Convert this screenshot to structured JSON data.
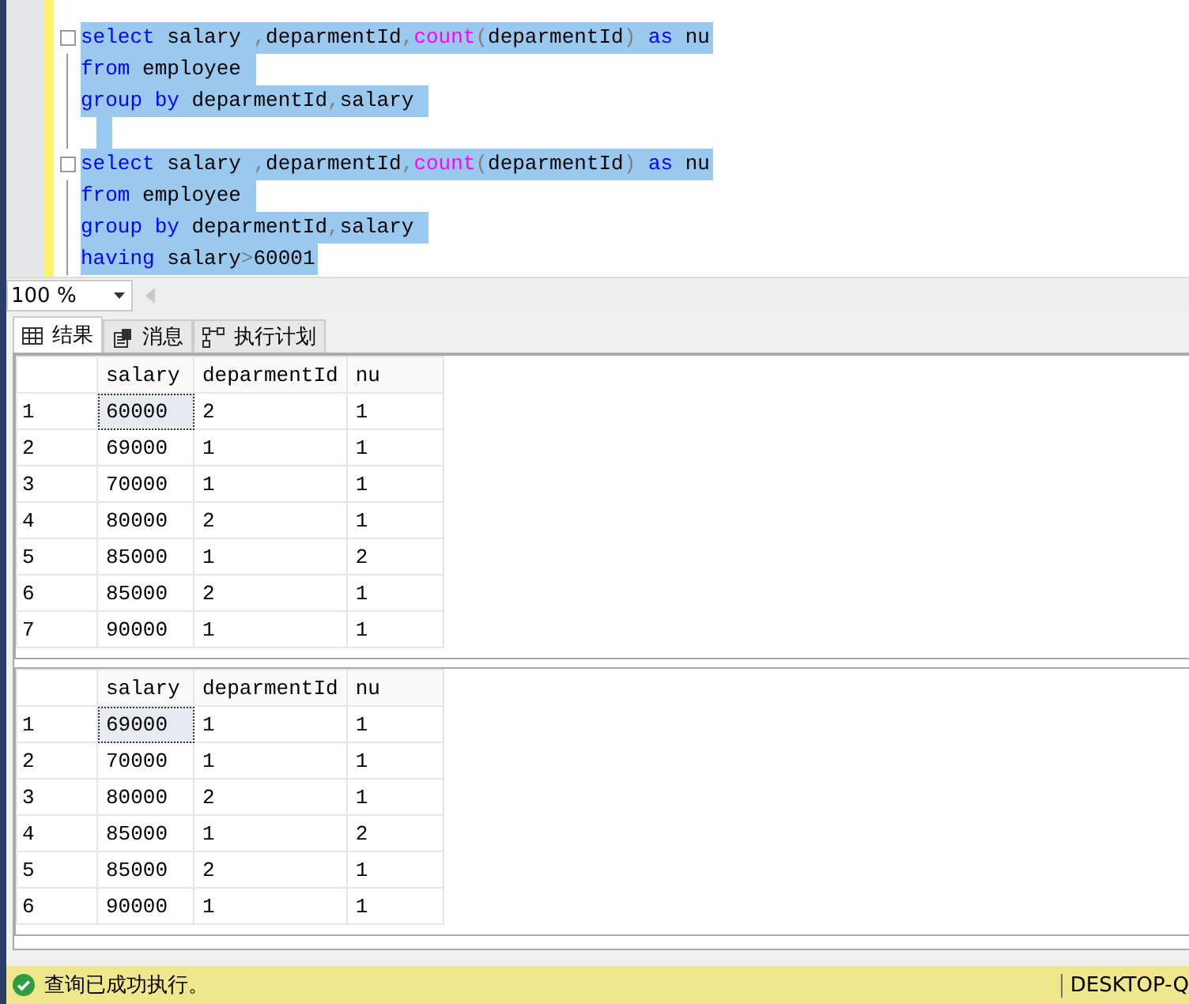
{
  "editor": {
    "lines": [
      {
        "tokens": [
          {
            "kind": "keyword",
            "text": "select"
          },
          {
            "kind": "plain",
            "text": " salary "
          },
          {
            "kind": "operator",
            "text": ","
          },
          {
            "kind": "plain",
            "text": "deparmentId"
          },
          {
            "kind": "operator",
            "text": ","
          },
          {
            "kind": "function",
            "text": "count"
          },
          {
            "kind": "operator",
            "text": "("
          },
          {
            "kind": "plain",
            "text": "deparmentId"
          },
          {
            "kind": "operator",
            "text": ")"
          },
          {
            "kind": "keyword",
            "text": " as"
          },
          {
            "kind": "plain",
            "text": " nu"
          }
        ],
        "selected": true,
        "fold": true
      },
      {
        "tokens": [
          {
            "kind": "keyword",
            "text": "from"
          },
          {
            "kind": "plain",
            "text": " employee "
          }
        ],
        "selected": true,
        "fold": false
      },
      {
        "tokens": [
          {
            "kind": "keyword",
            "text": "group"
          },
          {
            "kind": "keyword",
            "text": " by"
          },
          {
            "kind": "plain",
            "text": " deparmentId"
          },
          {
            "kind": "operator",
            "text": ","
          },
          {
            "kind": "plain",
            "text": "salary "
          }
        ],
        "selected": true,
        "fold": false
      },
      {
        "selected": true,
        "fold": false
      },
      {
        "tokens": [
          {
            "kind": "keyword",
            "text": "select"
          },
          {
            "kind": "plain",
            "text": " salary "
          },
          {
            "kind": "operator",
            "text": ","
          },
          {
            "kind": "plain",
            "text": "deparmentId"
          },
          {
            "kind": "operator",
            "text": ","
          },
          {
            "kind": "function",
            "text": "count"
          },
          {
            "kind": "operator",
            "text": "("
          },
          {
            "kind": "plain",
            "text": "deparmentId"
          },
          {
            "kind": "operator",
            "text": ")"
          },
          {
            "kind": "keyword",
            "text": " as"
          },
          {
            "kind": "plain",
            "text": " nu"
          }
        ],
        "selected": true,
        "fold": true
      },
      {
        "tokens": [
          {
            "kind": "keyword",
            "text": "from"
          },
          {
            "kind": "plain",
            "text": " employee "
          }
        ],
        "selected": true,
        "fold": false
      },
      {
        "tokens": [
          {
            "kind": "keyword",
            "text": "group"
          },
          {
            "kind": "keyword",
            "text": " by"
          },
          {
            "kind": "plain",
            "text": " deparmentId"
          },
          {
            "kind": "operator",
            "text": ","
          },
          {
            "kind": "plain",
            "text": "salary "
          }
        ],
        "selected": true,
        "fold": false
      },
      {
        "tokens": [
          {
            "kind": "keyword",
            "text": "having"
          },
          {
            "kind": "plain",
            "text": " salary"
          },
          {
            "kind": "operator",
            "text": ">"
          },
          {
            "kind": "plain",
            "text": "60001"
          }
        ],
        "selected": true,
        "fold": false
      }
    ]
  },
  "zoom": {
    "value": "100 %"
  },
  "tabs": [
    {
      "label": "结果",
      "selected": true
    },
    {
      "label": "消息",
      "selected": false
    },
    {
      "label": "执行计划",
      "selected": false
    }
  ],
  "grids": [
    {
      "columns": [
        "salary",
        "deparmentId",
        "nu"
      ],
      "rows": [
        {
          "number": "1",
          "cells": [
            "60000",
            "2",
            "1"
          ],
          "selected": true
        },
        {
          "number": "2",
          "cells": [
            "69000",
            "1",
            "1"
          ],
          "selected": false
        },
        {
          "number": "3",
          "cells": [
            "70000",
            "1",
            "1"
          ],
          "selected": false
        },
        {
          "number": "4",
          "cells": [
            "80000",
            "2",
            "1"
          ],
          "selected": false
        },
        {
          "number": "5",
          "cells": [
            "85000",
            "1",
            "2"
          ],
          "selected": false
        },
        {
          "number": "6",
          "cells": [
            "85000",
            "2",
            "1"
          ],
          "selected": false
        },
        {
          "number": "7",
          "cells": [
            "90000",
            "1",
            "1"
          ],
          "selected": false
        }
      ]
    },
    {
      "columns": [
        "salary",
        "deparmentId",
        "nu"
      ],
      "rows": [
        {
          "number": "1",
          "cells": [
            "69000",
            "1",
            "1"
          ],
          "selected": true
        },
        {
          "number": "2",
          "cells": [
            "70000",
            "1",
            "1"
          ],
          "selected": false
        },
        {
          "number": "3",
          "cells": [
            "80000",
            "2",
            "1"
          ],
          "selected": false
        },
        {
          "number": "4",
          "cells": [
            "85000",
            "1",
            "2"
          ],
          "selected": false
        },
        {
          "number": "5",
          "cells": [
            "85000",
            "2",
            "1"
          ],
          "selected": false
        },
        {
          "number": "6",
          "cells": [
            "90000",
            "1",
            "1"
          ],
          "selected": false
        }
      ]
    }
  ],
  "status_bar": {
    "message": "查询已成功执行。",
    "server": "DESKTOP-Q"
  }
}
